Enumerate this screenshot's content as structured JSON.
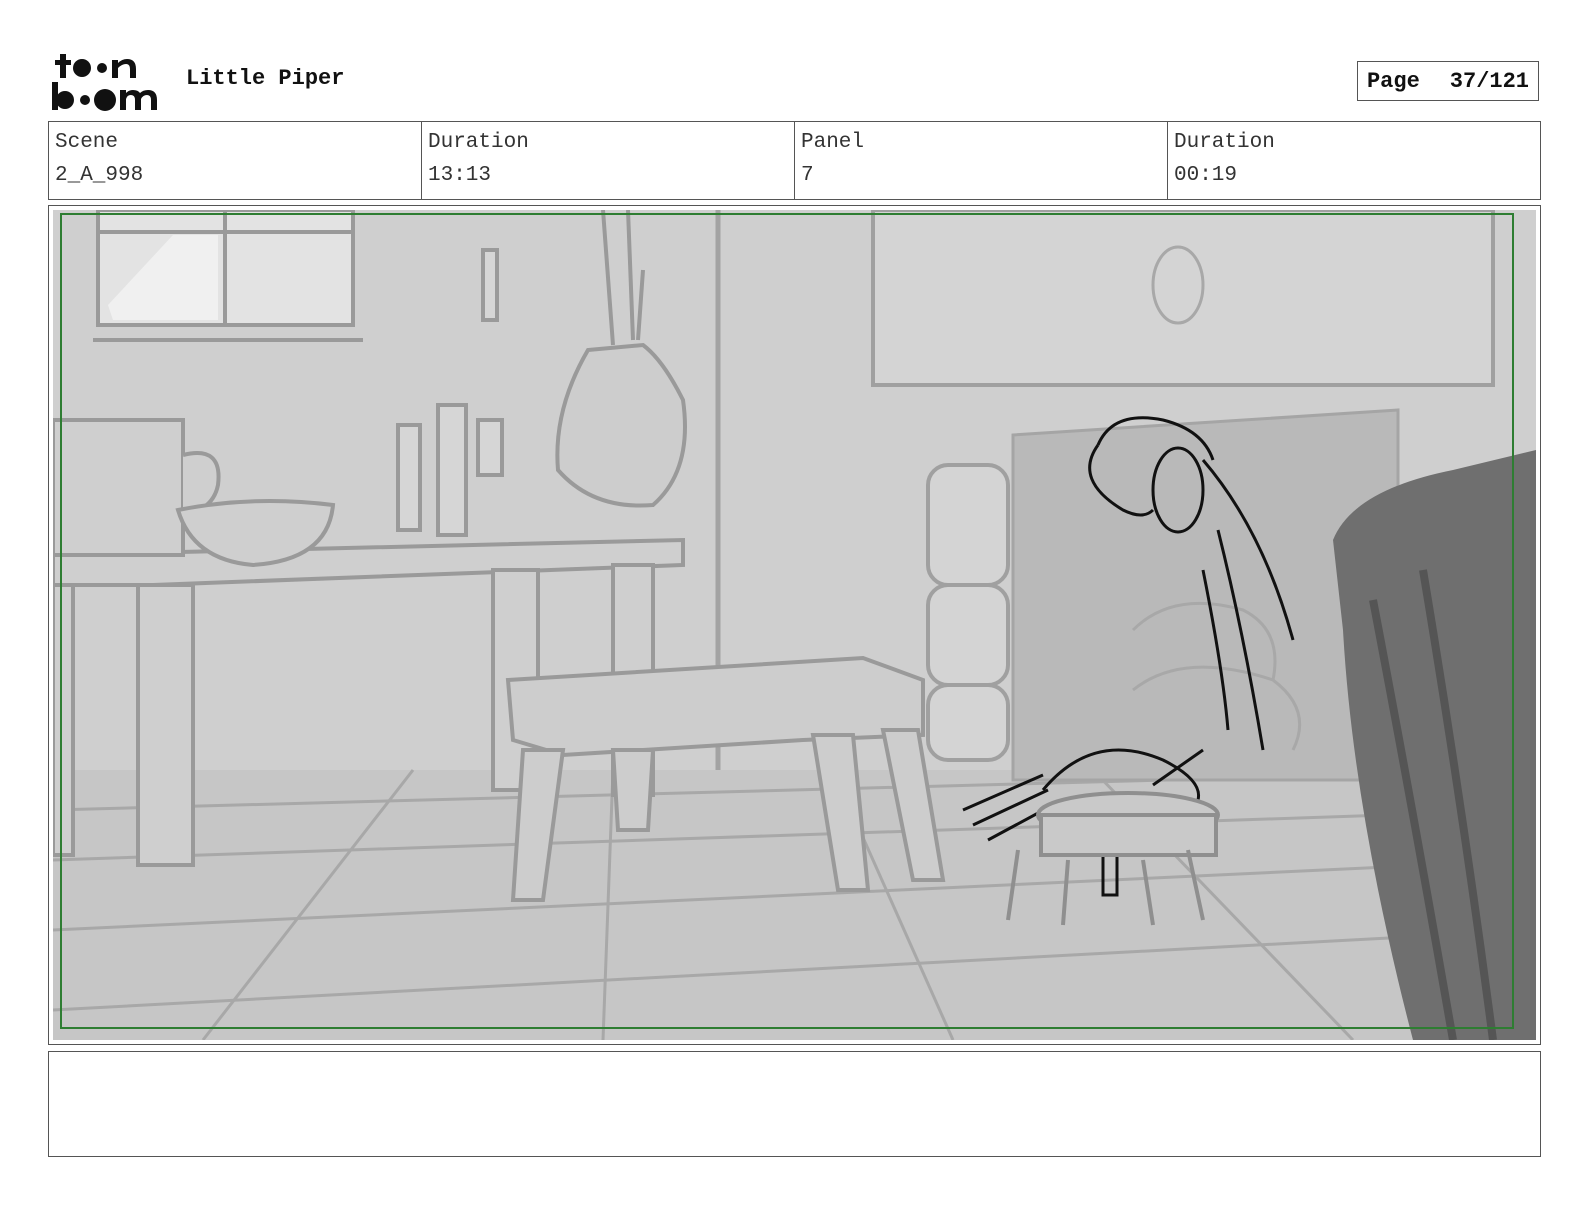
{
  "header": {
    "brand": "toon boom",
    "project_title": "Little Piper",
    "page_label": "Page",
    "page_value": "37/121"
  },
  "info": [
    {
      "label": "Scene",
      "value": "2_A_998"
    },
    {
      "label": "Duration",
      "value": "13:13"
    },
    {
      "label": "Panel",
      "value": "7"
    },
    {
      "label": "Duration",
      "value": "00:19"
    }
  ],
  "notes": "",
  "colors": {
    "safe_frame": "#2e7d32",
    "sketch_bg": "#cfcfcf",
    "sketch_line": "#9a9a9a",
    "character_line": "#111111",
    "curtain": "#6f6f6f"
  }
}
